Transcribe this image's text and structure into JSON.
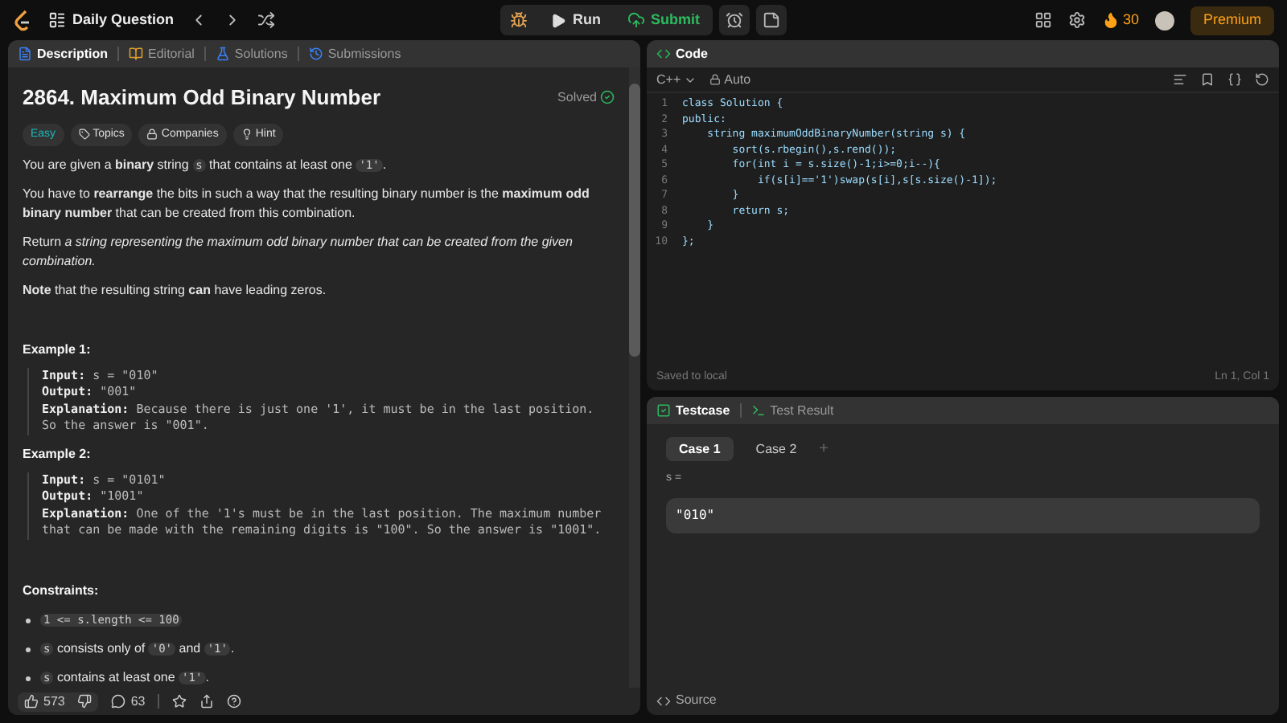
{
  "topbar": {
    "title": "Daily Question",
    "run": "Run",
    "submit": "Submit",
    "streak": "30",
    "premium": "Premium"
  },
  "left_tabs": [
    {
      "label": "Description",
      "selected": true
    },
    {
      "label": "Editorial",
      "selected": false
    },
    {
      "label": "Solutions",
      "selected": false
    },
    {
      "label": "Submissions",
      "selected": false
    }
  ],
  "problem": {
    "title": "2864. Maximum Odd Binary Number",
    "status": "Solved",
    "difficulty": "Easy",
    "tags": [
      "Topics",
      "Companies",
      "Hint"
    ],
    "paragraphs": [
      [
        {
          "kind": "text",
          "text": "You are given a **binary** string "
        },
        {
          "kind": "code",
          "text": "s"
        },
        {
          "kind": "text",
          "text": " that contains at least one "
        },
        {
          "kind": "code",
          "text": "'1'"
        },
        {
          "kind": "text",
          "text": "."
        }
      ],
      [
        {
          "kind": "text",
          "text": "You have to **rearrange** the bits in such a way that the resulting binary number is the **maximum odd binary number** that can be created from this combination."
        }
      ],
      [
        {
          "kind": "text",
          "text": "Return *a string representing the maximum odd binary number that can be created from the given combination.*"
        }
      ],
      [
        {
          "kind": "text",
          "text": "**Note** that the resulting string **can** have leading zeros."
        }
      ]
    ],
    "examples": [
      {
        "title": "Example 1:",
        "lines": [
          {
            "label": "Input:",
            "value": "s = \"010\""
          },
          {
            "label": "Output:",
            "value": "\"001\""
          },
          {
            "label": "Explanation:",
            "value": "Because there is just one '1', it must be in the last position. So the answer is \"001\"."
          }
        ]
      },
      {
        "title": "Example 2:",
        "lines": [
          {
            "label": "Input:",
            "value": "s = \"0101\""
          },
          {
            "label": "Output:",
            "value": "\"1001\""
          },
          {
            "label": "Explanation:",
            "value": "One of the '1's must be in the last position. The maximum number that can be made with the remaining digits is \"100\". So the answer is \"1001\"."
          }
        ]
      }
    ],
    "constraints_title": "Constraints:",
    "constraints": [
      [
        {
          "kind": "code",
          "text": "1 <= s.length <= 100"
        }
      ],
      [
        {
          "kind": "code",
          "text": "s"
        },
        {
          "kind": "text",
          "text": " consists only of "
        },
        {
          "kind": "code",
          "text": "'0'"
        },
        {
          "kind": "text",
          "text": " and "
        },
        {
          "kind": "code",
          "text": "'1'"
        },
        {
          "kind": "text",
          "text": "."
        }
      ],
      [
        {
          "kind": "code",
          "text": "s"
        },
        {
          "kind": "text",
          "text": " contains at least one "
        },
        {
          "kind": "code",
          "text": "'1'"
        },
        {
          "kind": "text",
          "text": "."
        }
      ]
    ]
  },
  "footer": {
    "likes": "573",
    "comments": "63"
  },
  "code": {
    "title": "Code",
    "language": "C++",
    "mode": "Auto",
    "lines": [
      {
        "number": "1",
        "text": "class Solution {"
      },
      {
        "number": "2",
        "text": "public:"
      },
      {
        "number": "3",
        "text": "    string maximumOddBinaryNumber(string s) {"
      },
      {
        "number": "4",
        "text": "        sort(s.rbegin(),s.rend());"
      },
      {
        "number": "5",
        "text": "        for(int i = s.size()-1;i>=0;i--){"
      },
      {
        "number": "6",
        "text": "            if(s[i]=='1')swap(s[i],s[s.size()-1]);"
      },
      {
        "number": "7",
        "text": "        }"
      },
      {
        "number": "8",
        "text": "        return s;"
      },
      {
        "number": "9",
        "text": "    }"
      },
      {
        "number": "10",
        "text": "};"
      }
    ],
    "saved": "Saved to local",
    "cursor": "Ln 1, Col 1"
  },
  "test_tabs": [
    {
      "label": "Testcase",
      "selected": true
    },
    {
      "label": "Test Result",
      "selected": false
    }
  ],
  "cases": [
    {
      "label": "Case 1",
      "selected": true
    },
    {
      "label": "Case 2",
      "selected": false
    }
  ],
  "add_case": "+",
  "input_label": "s =",
  "input_value": "\"010\"",
  "source": "Source"
}
